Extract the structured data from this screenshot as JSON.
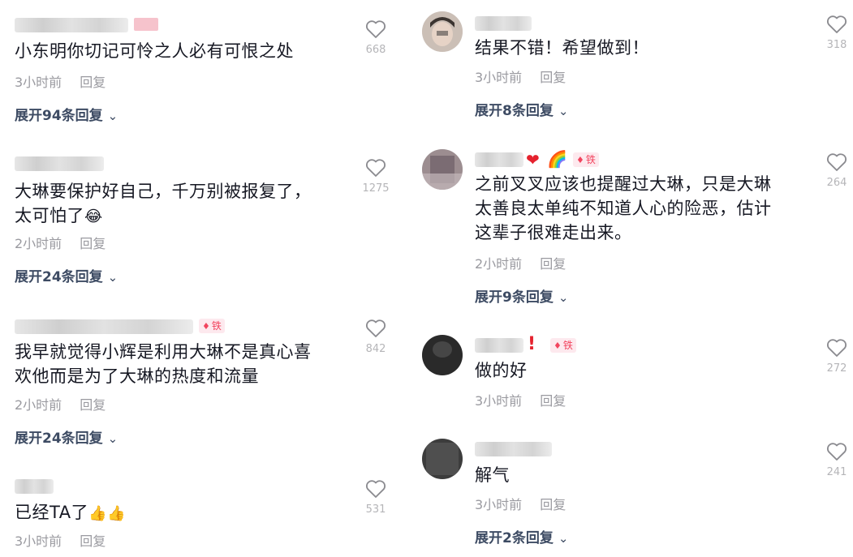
{
  "left_comments": [
    {
      "text": "小东明你切记可怜之人必有可恨之处",
      "time": "3小时前",
      "reply": "回复",
      "expand": "展开94条回复",
      "likes": "668"
    },
    {
      "text_line1": "大琳要保护好自己，千万别被报复了，",
      "text_line2": "太可怕了",
      "time": "2小时前",
      "reply": "回复",
      "expand": "展开24条回复",
      "likes": "1275"
    },
    {
      "badge": "铁",
      "text_line1": "我早就觉得小辉是利用大琳不是真心喜",
      "text_line2": "欢他而是为了大琳的热度和流量",
      "time": "2小时前",
      "reply": "回复",
      "expand": "展开24条回复",
      "likes": "842"
    },
    {
      "text": "已经TA了",
      "time": "3小时前",
      "reply": "回复",
      "likes": "531"
    }
  ],
  "right_comments": [
    {
      "text": "结果不错！希望做到！",
      "time": "3小时前",
      "reply": "回复",
      "expand": "展开8条回复",
      "likes": "318"
    },
    {
      "badge": "铁",
      "text_line1": "之前叉叉应该也提醒过大琳，只是大琳",
      "text_line2": "太善良太单纯不知道人心的险恶，估计",
      "text_line3": "这辈子很难走出来。",
      "time": "2小时前",
      "reply": "回复",
      "expand": "展开9条回复",
      "likes": "264"
    },
    {
      "badge": "铁",
      "text": "做的好",
      "time": "3小时前",
      "reply": "回复",
      "likes": "272"
    },
    {
      "text": "解气",
      "time": "3小时前",
      "reply": "回复",
      "expand": "展开2条回复",
      "likes": "241"
    }
  ],
  "icons": {
    "chevron": "⌄",
    "heart": "heart-outline-icon",
    "gem": "♦",
    "laugh_emoji": "😂",
    "thumbs_emoji": "👍👍",
    "rainbow_emoji": "🌈",
    "heart_emoji": "❤"
  },
  "colors": {
    "text": "#161823",
    "meta": "#9a9aa0",
    "expand": "#3d4b63",
    "badge_bg": "#fde9ee",
    "badge_fg": "#f2445e",
    "like_count": "#b5b5b8"
  }
}
